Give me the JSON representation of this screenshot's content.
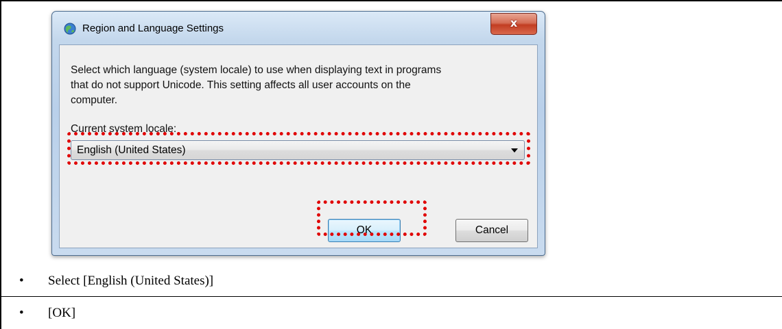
{
  "dialog": {
    "title": "Region and Language Settings",
    "close_label": "x",
    "description_lines": [
      "Select which language (system locale) to use when displaying text in programs",
      "that do not support Unicode. This setting affects all user accounts on the",
      "computer."
    ],
    "locale_label": "Current system locale:",
    "locale_value": "English (United States)",
    "ok_label": "OK",
    "cancel_label": "Cancel"
  },
  "instructions": [
    {
      "bullet": "•",
      "text": "Select [English (United States)]"
    },
    {
      "bullet": "•",
      "text": "[OK]"
    }
  ],
  "colors": {
    "highlight": "#e00000",
    "close_button": "#c23d22"
  }
}
